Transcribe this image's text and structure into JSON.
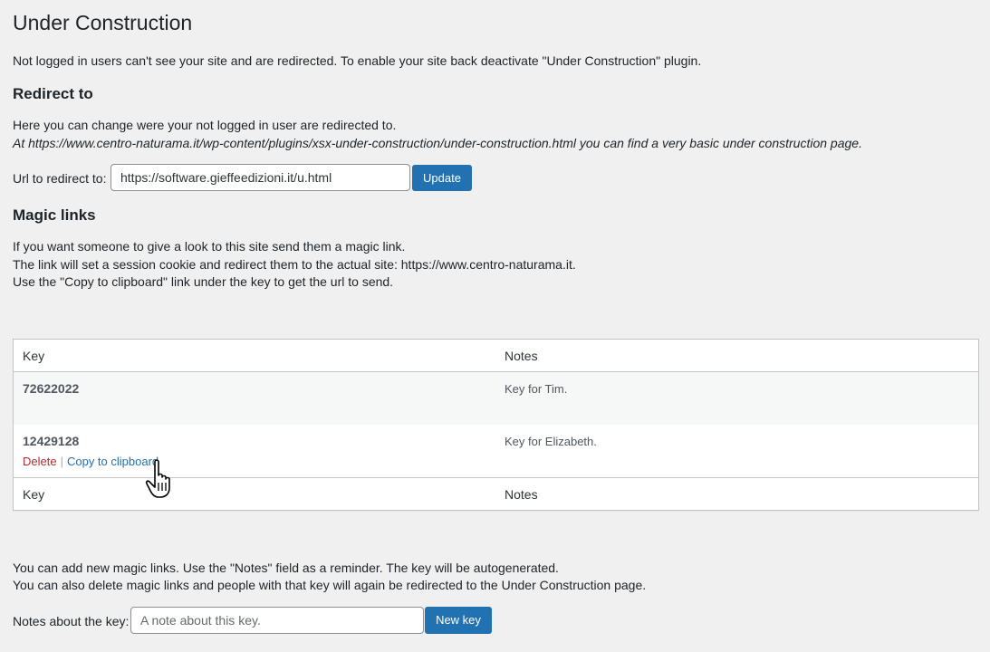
{
  "page": {
    "title": "Under Construction",
    "intro": "Not logged in users can't see your site and are redirected. To enable your site back deactivate \"Under Construction\" plugin."
  },
  "redirect": {
    "heading": "Redirect to",
    "line1": "Here you can change were your not logged in user are redirected to.",
    "line2": "At https://www.centro-naturama.it/wp-content/plugins/xsx-under-construction/under-construction.html you can find a very basic under construction page.",
    "url_label": "Url to redirect to:",
    "url_value": "https://software.gieffeedizioni.it/u.html",
    "update_label": "Update"
  },
  "magic": {
    "heading": "Magic links",
    "line1": "If you want someone to give a look to this site send them a magic link.",
    "line2": "The link will set a session cookie and redirect them to the actual site: https://www.centro-naturama.it.",
    "line3": "Use the \"Copy to clipboard\" link under the key to get the url to send."
  },
  "table": {
    "col_key": "Key",
    "col_notes": "Notes",
    "rows": [
      {
        "key": "72622022",
        "notes": "Key for Tim."
      },
      {
        "key": "12429128",
        "notes": "Key for Elizabeth.",
        "delete_label": "Delete",
        "separator": "|",
        "copy_label": "Copy to clipboard"
      }
    ]
  },
  "add": {
    "line1": "You can add new magic links. Use the \"Notes\" field as a reminder. The key will be autogenerated.",
    "line2": "You can also delete magic links and people with that key will again be redirected to the Under Construction page.",
    "notes_label": "Notes about the key:",
    "notes_placeholder": "A note about this key.",
    "newkey_label": "New key"
  },
  "icons": {
    "cursor": "hand-pointer-icon"
  },
  "colors": {
    "accent": "#2271b1",
    "delete": "#b32d2e",
    "background": "#f0f0f1"
  }
}
